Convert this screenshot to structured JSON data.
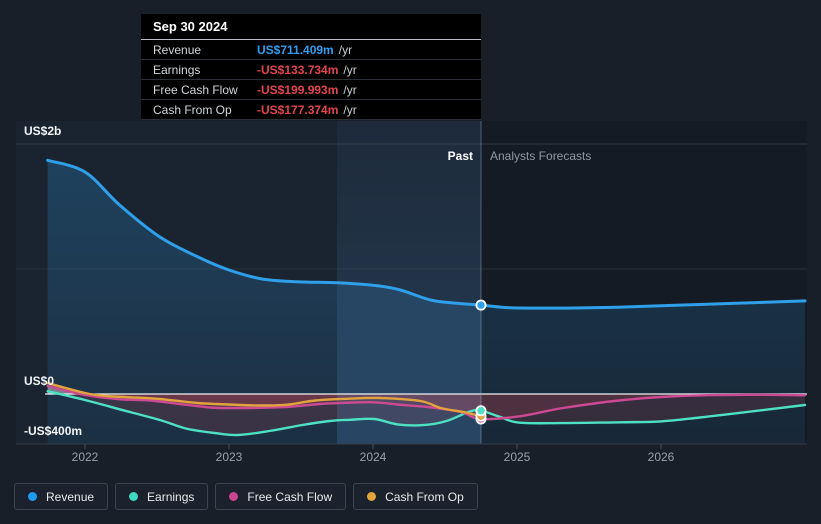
{
  "tooltip": {
    "date": "Sep 30 2024",
    "rows": [
      {
        "label": "Revenue",
        "value": "US$711.409m",
        "suffix": "/yr",
        "value_color": "#2e9ff2"
      },
      {
        "label": "Earnings",
        "value": "-US$133.734m",
        "suffix": "/yr",
        "value_color": "#e4454e"
      },
      {
        "label": "Free Cash Flow",
        "value": "-US$199.993m",
        "suffix": "/yr",
        "value_color": "#e4454e"
      },
      {
        "label": "Cash From Op",
        "value": "-US$177.374m",
        "suffix": "/yr",
        "value_color": "#e4454e"
      }
    ]
  },
  "legend": {
    "items": [
      {
        "label": "Revenue",
        "color": "#1e9bf0"
      },
      {
        "label": "Earnings",
        "color": "#3fd9c0"
      },
      {
        "label": "Free Cash Flow",
        "color": "#c9458f"
      },
      {
        "label": "Cash From Op",
        "color": "#e3a43c"
      }
    ]
  },
  "chart_data": {
    "type": "area",
    "values_unit": "US$ millions",
    "x_axis": {
      "ticks": [
        2022,
        2023,
        2024,
        2025,
        2026
      ],
      "labels": [
        "2022",
        "2023",
        "2024",
        "2025",
        "2026"
      ],
      "range": [
        2021.55,
        2027.1
      ]
    },
    "y_axis": {
      "ticks": [
        {
          "label": "US$2b",
          "value": 2000
        },
        {
          "label": "US$0",
          "value": 0
        },
        {
          "label": "-US$400m",
          "value": -400
        }
      ],
      "grid_values": [
        2000,
        1000
      ],
      "range": [
        -400,
        2000
      ]
    },
    "divider": {
      "x": 2024.75,
      "past_label": "Past",
      "forecast_label": "Analysts Forecasts"
    },
    "highlight_band": [
      2023.75,
      2024.75
    ],
    "series": [
      {
        "name": "Revenue",
        "color": "#2e9fe8",
        "width": 3,
        "fill_style": "blue",
        "past": [
          [
            2021.74,
            1870
          ],
          [
            2022.0,
            1776
          ],
          [
            2022.24,
            1512
          ],
          [
            2022.52,
            1256
          ],
          [
            2022.8,
            1088
          ],
          [
            2023.0,
            992
          ],
          [
            2023.23,
            920
          ],
          [
            2023.49,
            897
          ],
          [
            2023.75,
            890
          ],
          [
            2024.03,
            866
          ],
          [
            2024.19,
            832
          ],
          [
            2024.4,
            752
          ],
          [
            2024.57,
            727
          ],
          [
            2024.75,
            711.409
          ]
        ],
        "forecast": [
          [
            2024.75,
            711.409
          ],
          [
            2024.95,
            690
          ],
          [
            2025.3,
            687
          ],
          [
            2025.72,
            695
          ],
          [
            2026.13,
            711
          ],
          [
            2026.55,
            727
          ],
          [
            2027.0,
            745
          ]
        ]
      },
      {
        "name": "Earnings",
        "color": "#4ee0c3",
        "width": 2.4,
        "fill_style": "signed",
        "past": [
          [
            2021.74,
            22
          ],
          [
            2022.0,
            -48
          ],
          [
            2022.24,
            -122
          ],
          [
            2022.52,
            -208
          ],
          [
            2022.7,
            -276
          ],
          [
            2022.9,
            -312
          ],
          [
            2023.06,
            -328
          ],
          [
            2023.28,
            -296
          ],
          [
            2023.51,
            -248
          ],
          [
            2023.7,
            -216
          ],
          [
            2023.84,
            -206
          ],
          [
            2024.01,
            -200
          ],
          [
            2024.17,
            -243
          ],
          [
            2024.35,
            -249
          ],
          [
            2024.51,
            -216
          ],
          [
            2024.67,
            -141
          ],
          [
            2024.75,
            -133.734
          ]
        ],
        "forecast": [
          [
            2024.75,
            -133.734
          ],
          [
            2024.88,
            -182
          ],
          [
            2025.01,
            -229
          ],
          [
            2025.3,
            -233
          ],
          [
            2025.72,
            -226
          ],
          [
            2026.0,
            -219
          ],
          [
            2026.27,
            -188
          ],
          [
            2026.55,
            -150
          ],
          [
            2027.0,
            -88
          ]
        ]
      },
      {
        "name": "Free Cash Flow",
        "color": "#cb4a92",
        "width": 2.4,
        "fill_style": "signed",
        "past": [
          [
            2021.74,
            64
          ],
          [
            2022.0,
            -8
          ],
          [
            2022.24,
            -42
          ],
          [
            2022.45,
            -52
          ],
          [
            2022.66,
            -80
          ],
          [
            2022.87,
            -108
          ],
          [
            2023.01,
            -112
          ],
          [
            2023.22,
            -110
          ],
          [
            2023.42,
            -102
          ],
          [
            2023.63,
            -80
          ],
          [
            2023.81,
            -70
          ],
          [
            2024.0,
            -66
          ],
          [
            2024.17,
            -84
          ],
          [
            2024.4,
            -106
          ],
          [
            2024.55,
            -132
          ],
          [
            2024.63,
            -150
          ],
          [
            2024.75,
            -199.993
          ]
        ],
        "forecast": [
          [
            2024.75,
            -199.993
          ],
          [
            2025.02,
            -178
          ],
          [
            2025.32,
            -112
          ],
          [
            2025.74,
            -48
          ],
          [
            2026.13,
            -16
          ],
          [
            2026.6,
            -6
          ],
          [
            2027.0,
            -10
          ]
        ]
      },
      {
        "name": "Cash From Op",
        "color": "#e2a33e",
        "width": 2.4,
        "fill_style": "signed",
        "past": [
          [
            2021.74,
            88
          ],
          [
            2022.0,
            8
          ],
          [
            2022.15,
            -16
          ],
          [
            2022.31,
            -26
          ],
          [
            2022.52,
            -40
          ],
          [
            2022.78,
            -72
          ],
          [
            2023.0,
            -84
          ],
          [
            2023.2,
            -92
          ],
          [
            2023.4,
            -86
          ],
          [
            2023.6,
            -52
          ],
          [
            2023.82,
            -38
          ],
          [
            2024.05,
            -32
          ],
          [
            2024.33,
            -56
          ],
          [
            2024.47,
            -112
          ],
          [
            2024.63,
            -145
          ],
          [
            2024.75,
            -177.374
          ]
        ],
        "forecast": []
      }
    ]
  }
}
